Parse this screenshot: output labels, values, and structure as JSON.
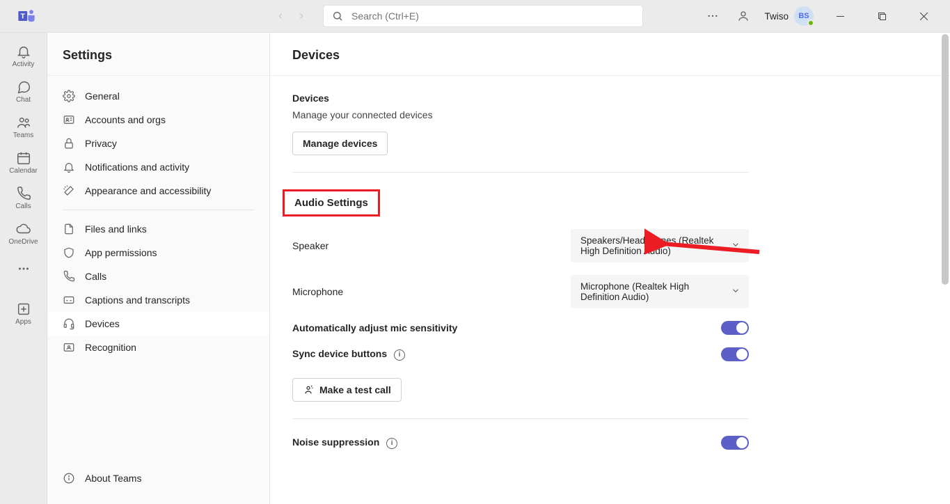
{
  "search": {
    "placeholder": "Search (Ctrl+E)"
  },
  "user": {
    "name": "Twiso",
    "initials": "BS"
  },
  "rail": [
    {
      "label": "Activity"
    },
    {
      "label": "Chat"
    },
    {
      "label": "Teams"
    },
    {
      "label": "Calendar"
    },
    {
      "label": "Calls"
    },
    {
      "label": "OneDrive"
    },
    {
      "label": "Apps"
    }
  ],
  "settings": {
    "title": "Settings",
    "items": [
      {
        "label": "General"
      },
      {
        "label": "Accounts and orgs"
      },
      {
        "label": "Privacy"
      },
      {
        "label": "Notifications and activity"
      },
      {
        "label": "Appearance and accessibility"
      },
      {
        "label": "Files and links"
      },
      {
        "label": "App permissions"
      },
      {
        "label": "Calls"
      },
      {
        "label": "Captions and transcripts"
      },
      {
        "label": "Devices"
      },
      {
        "label": "Recognition"
      }
    ],
    "about": "About Teams"
  },
  "main": {
    "title": "Devices",
    "devices": {
      "heading": "Devices",
      "desc": "Manage your connected devices",
      "button": "Manage devices"
    },
    "audio": {
      "heading": "Audio Settings",
      "speaker_label": "Speaker",
      "speaker_value": "Speakers/Headphones (Realtek High Definition Audio)",
      "mic_label": "Microphone",
      "mic_value": "Microphone (Realtek High Definition Audio)",
      "auto_mic": "Automatically adjust mic sensitivity",
      "sync": "Sync device buttons",
      "test_call": "Make a test call"
    },
    "noise": {
      "heading": "Noise suppression"
    }
  }
}
